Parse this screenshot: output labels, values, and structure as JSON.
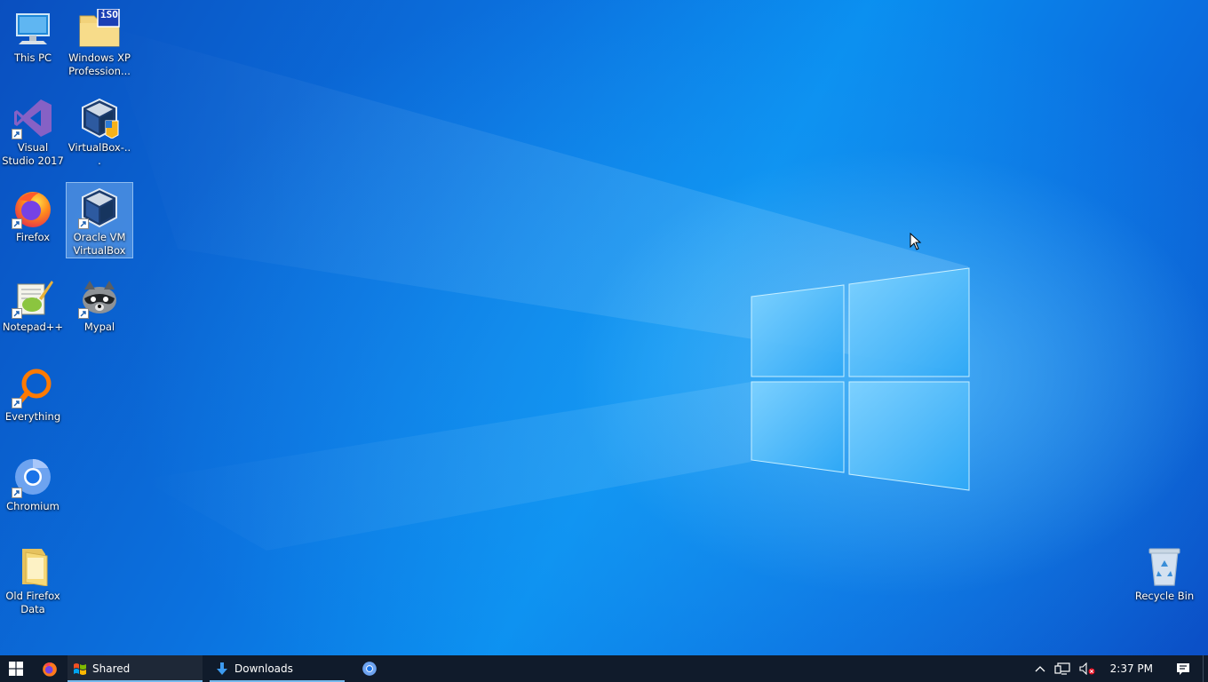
{
  "desktop": {
    "icons": [
      {
        "label": "This PC",
        "icon": "this-pc-icon",
        "shortcut": false
      },
      {
        "label": "Windows XP Profession...",
        "icon": "iso-file-icon",
        "badge": "iSO",
        "shortcut": false
      },
      {
        "label": "Visual Studio 2017",
        "icon": "visual-studio-icon",
        "shortcut": true
      },
      {
        "label": "VirtualBox-...",
        "icon": "virtualbox-installer-icon",
        "shortcut": false
      },
      {
        "label": "Firefox",
        "icon": "firefox-icon",
        "shortcut": true
      },
      {
        "label": "Oracle VM VirtualBox",
        "icon": "virtualbox-icon",
        "shortcut": true,
        "selected": true
      },
      {
        "label": "Notepad++",
        "icon": "notepad-plus-plus-icon",
        "shortcut": true
      },
      {
        "label": "Mypal",
        "icon": "mypal-icon",
        "shortcut": true
      },
      {
        "label": "Everything",
        "icon": "everything-search-icon",
        "shortcut": true
      },
      {
        "label": "Chromium",
        "icon": "chromium-icon",
        "shortcut": true
      },
      {
        "label": "Old Firefox Data",
        "icon": "folder-icon",
        "shortcut": false
      },
      {
        "label": "Recycle Bin",
        "icon": "recycle-bin-icon",
        "shortcut": false
      }
    ]
  },
  "taskbar": {
    "start_icon": "windows-logo-icon",
    "pinned": [
      {
        "icon": "firefox-icon"
      }
    ],
    "apps": [
      {
        "label": "Shared",
        "icon": "windows-xp-flag-icon"
      },
      {
        "label": "Downloads",
        "icon": "download-arrow-icon"
      }
    ],
    "extra_pinned": [
      {
        "icon": "chromium-icon"
      }
    ],
    "tray": {
      "chevron_icon": "chevron-up-icon",
      "network_icon": "network-icon",
      "volume_icon": "volume-muted-icon",
      "clock": "2:37 PM",
      "notifications_icon": "action-center-icon"
    }
  },
  "colors": {
    "wallpaper_base": "#0a63d6",
    "taskbar": "#101b2b",
    "taskbar_accent": "#76b9ed"
  }
}
